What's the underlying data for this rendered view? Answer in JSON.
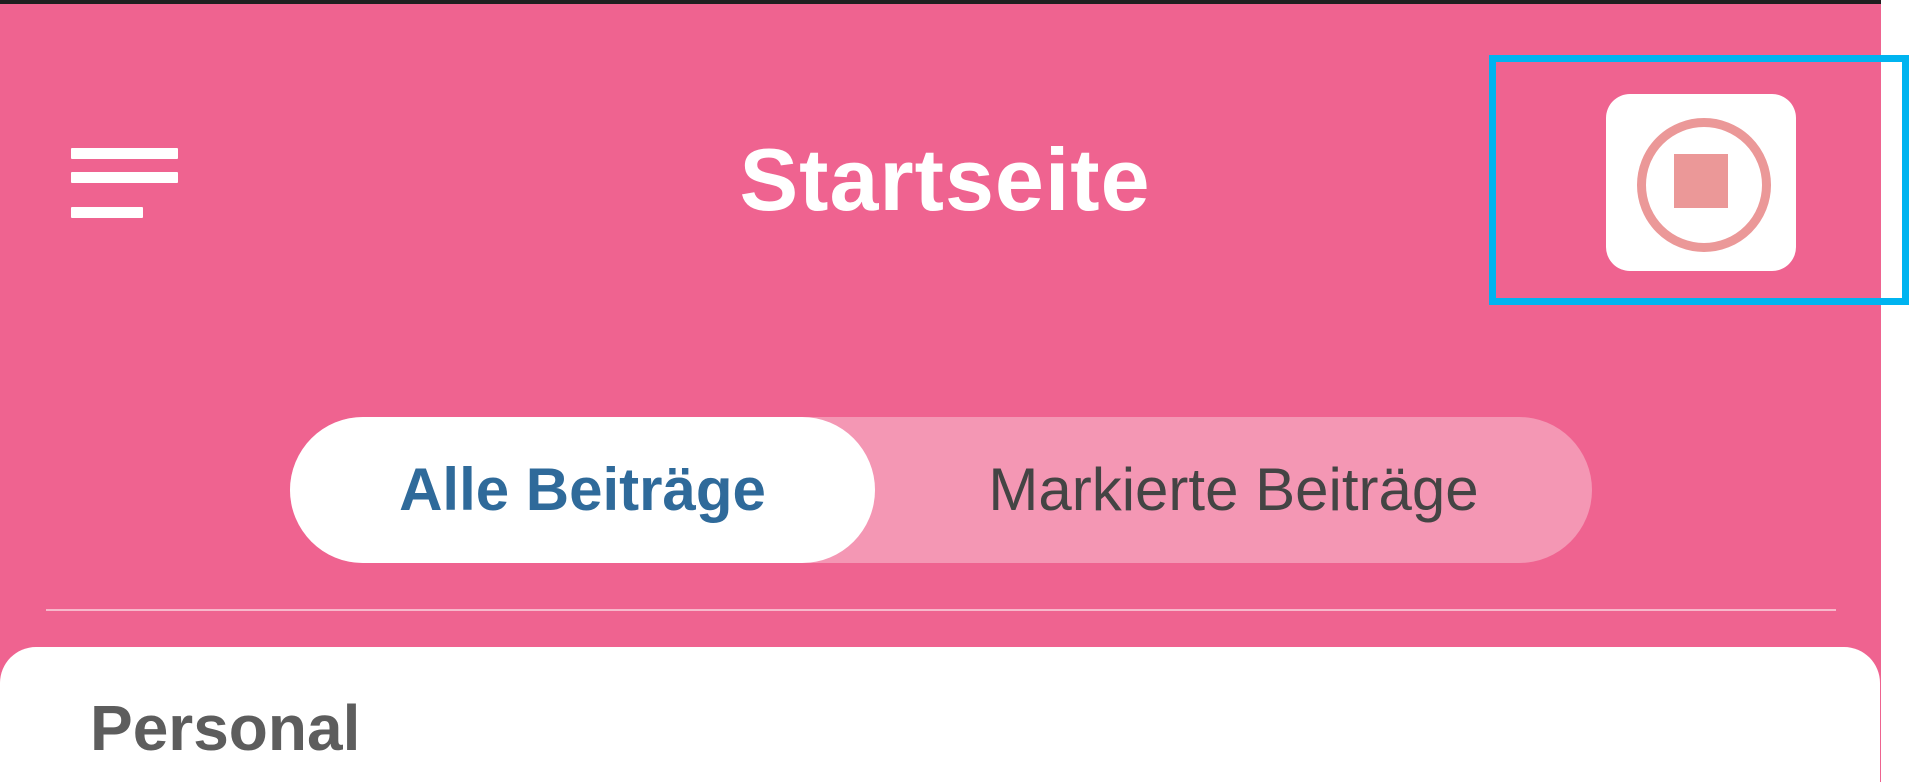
{
  "header": {
    "title": "Startseite",
    "menu_icon": "hamburger-menu-icon",
    "stop_icon": "stop-circle-icon"
  },
  "tabs": [
    {
      "label": "Alle Beiträge",
      "active": true
    },
    {
      "label": "Markierte Beiträge",
      "active": false
    }
  ],
  "content": {
    "section_title": "Personal"
  },
  "colors": {
    "primary": "#ef6390",
    "segment_bg": "#f497b4",
    "active_tab_text": "#2f6a9a",
    "stop_icon": "#eb9898",
    "highlight": "#00b4f0"
  }
}
